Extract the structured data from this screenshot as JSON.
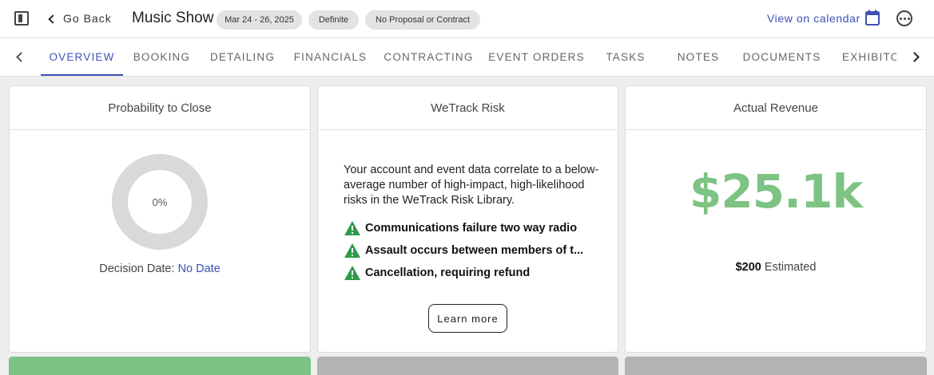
{
  "header": {
    "back_label": "Go Back",
    "title": "Music Show",
    "dates": "Mar 24 - 26, 2025",
    "status": "Definite",
    "proposal": "No Proposal or Contract",
    "view_calendar": "View on calendar"
  },
  "tabs": [
    {
      "label": "OVERVIEW",
      "active": true
    },
    {
      "label": "BOOKING"
    },
    {
      "label": "DETAILING"
    },
    {
      "label": "FINANCIALS"
    },
    {
      "label": "CONTRACTING"
    },
    {
      "label": "EVENT ORDERS"
    },
    {
      "label": "TASKS"
    },
    {
      "label": "NOTES"
    },
    {
      "label": "DOCUMENTS"
    },
    {
      "label": "EXHIBITO"
    }
  ],
  "probability_card": {
    "title": "Probability to Close",
    "percent_label": "0%",
    "probability": 0,
    "decision_label": "Decision Date:",
    "decision_value": "No Date"
  },
  "risk_card": {
    "title": "WeTrack Risk",
    "description": "Your account and event data correlate to a below-average number of high-impact, high-likelihood risks in the WeTrack Risk Library.",
    "risks": [
      "Communications failure two way radio",
      "Assault occurs between members of t...",
      "Cancellation, requiring refund"
    ],
    "learn_more": "Learn more"
  },
  "revenue_card": {
    "title": "Actual Revenue",
    "amount": "$25.1k",
    "estimated_amount": "$200",
    "estimated_label": "Estimated"
  },
  "colors": {
    "accent": "#3f51b5",
    "revenue_green": "#7dc383",
    "warning_green": "#2e9a4b",
    "bar_green": "#7dc383",
    "bar_gray": "#b3b3b3"
  }
}
